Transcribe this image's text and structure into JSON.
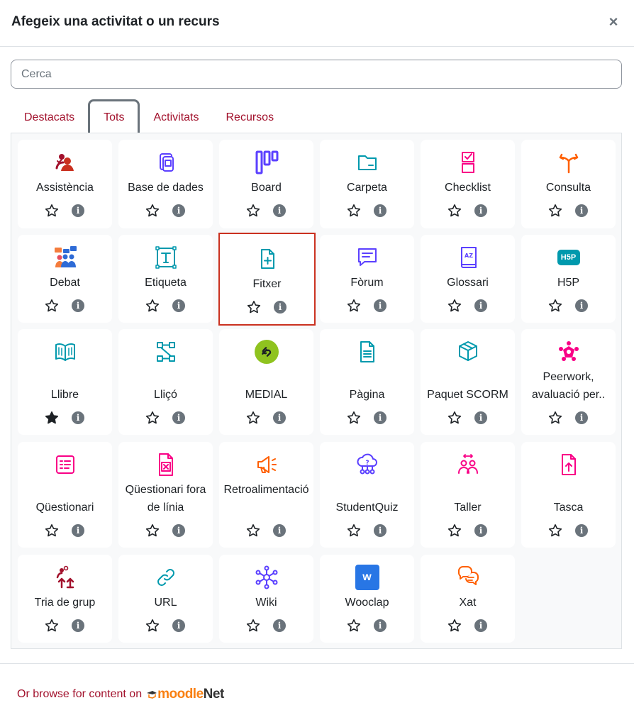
{
  "dialog": {
    "title": "Afegeix una activitat o un recurs",
    "close_glyph": "×"
  },
  "search": {
    "placeholder": "Cerca",
    "value": ""
  },
  "tabs": [
    {
      "label": "Destacats",
      "active": false
    },
    {
      "label": "Tots",
      "active": true
    },
    {
      "label": "Activitats",
      "active": false
    },
    {
      "label": "Recursos",
      "active": false
    }
  ],
  "colors": {
    "accent": "#a2112c",
    "admin": "#a2112c",
    "collaboration": "#5b40ff",
    "communication": "#eb66a2",
    "content": "#0099ad",
    "assessment": "#f90086",
    "interactive": "#ff5f00"
  },
  "modules": [
    {
      "name": "Assistència",
      "icon": "attendance-icon",
      "starred": false
    },
    {
      "name": "Base de dades",
      "icon": "database-icon",
      "starred": false
    },
    {
      "name": "Board",
      "icon": "board-icon",
      "starred": false
    },
    {
      "name": "Carpeta",
      "icon": "folder-icon",
      "starred": false
    },
    {
      "name": "Checklist",
      "icon": "checklist-icon",
      "starred": false
    },
    {
      "name": "Consulta",
      "icon": "choice-icon",
      "starred": false
    },
    {
      "name": "Debat",
      "icon": "debate-icon",
      "starred": false
    },
    {
      "name": "Etiqueta",
      "icon": "label-icon",
      "starred": false
    },
    {
      "name": "Fitxer",
      "icon": "file-icon",
      "starred": false,
      "selected": true
    },
    {
      "name": "Fòrum",
      "icon": "forum-icon",
      "starred": false
    },
    {
      "name": "Glossari",
      "icon": "glossary-icon",
      "starred": false
    },
    {
      "name": "H5P",
      "icon": "h5p-icon",
      "starred": false,
      "badge": "H5P"
    },
    {
      "name": "Llibre",
      "icon": "book-icon",
      "starred": true
    },
    {
      "name": "Lliçó",
      "icon": "lesson-icon",
      "starred": false
    },
    {
      "name": "MEDIAL",
      "icon": "medial-icon",
      "starred": false
    },
    {
      "name": "Pàgina",
      "icon": "page-icon",
      "starred": false
    },
    {
      "name": "Paquet SCORM",
      "icon": "scorm-icon",
      "starred": false
    },
    {
      "name": "Peerwork, avaluació per..",
      "icon": "peerwork-icon",
      "starred": false
    },
    {
      "name": "Qüestionari",
      "icon": "quiz-icon",
      "starred": false
    },
    {
      "name": "Qüestionari fora de línia",
      "icon": "offline-quiz-icon",
      "starred": false
    },
    {
      "name": "Retroalimentació",
      "icon": "feedback-icon",
      "starred": false
    },
    {
      "name": "StudentQuiz",
      "icon": "studentquiz-icon",
      "starred": false
    },
    {
      "name": "Taller",
      "icon": "workshop-icon",
      "starred": false
    },
    {
      "name": "Tasca",
      "icon": "assignment-icon",
      "starred": false
    },
    {
      "name": "Tria de grup",
      "icon": "group-choice-icon",
      "starred": false
    },
    {
      "name": "URL",
      "icon": "url-icon",
      "starred": false
    },
    {
      "name": "Wiki",
      "icon": "wiki-icon",
      "starred": false
    },
    {
      "name": "Wooclap",
      "icon": "wooclap-icon",
      "starred": false,
      "badge": "w"
    },
    {
      "name": "Xat",
      "icon": "chat-icon",
      "starred": false
    }
  ],
  "info_glyph": "i",
  "footer": {
    "browse_text": "Or browse for content on",
    "brand_prefix": "moodle",
    "brand_suffix": "Net"
  }
}
